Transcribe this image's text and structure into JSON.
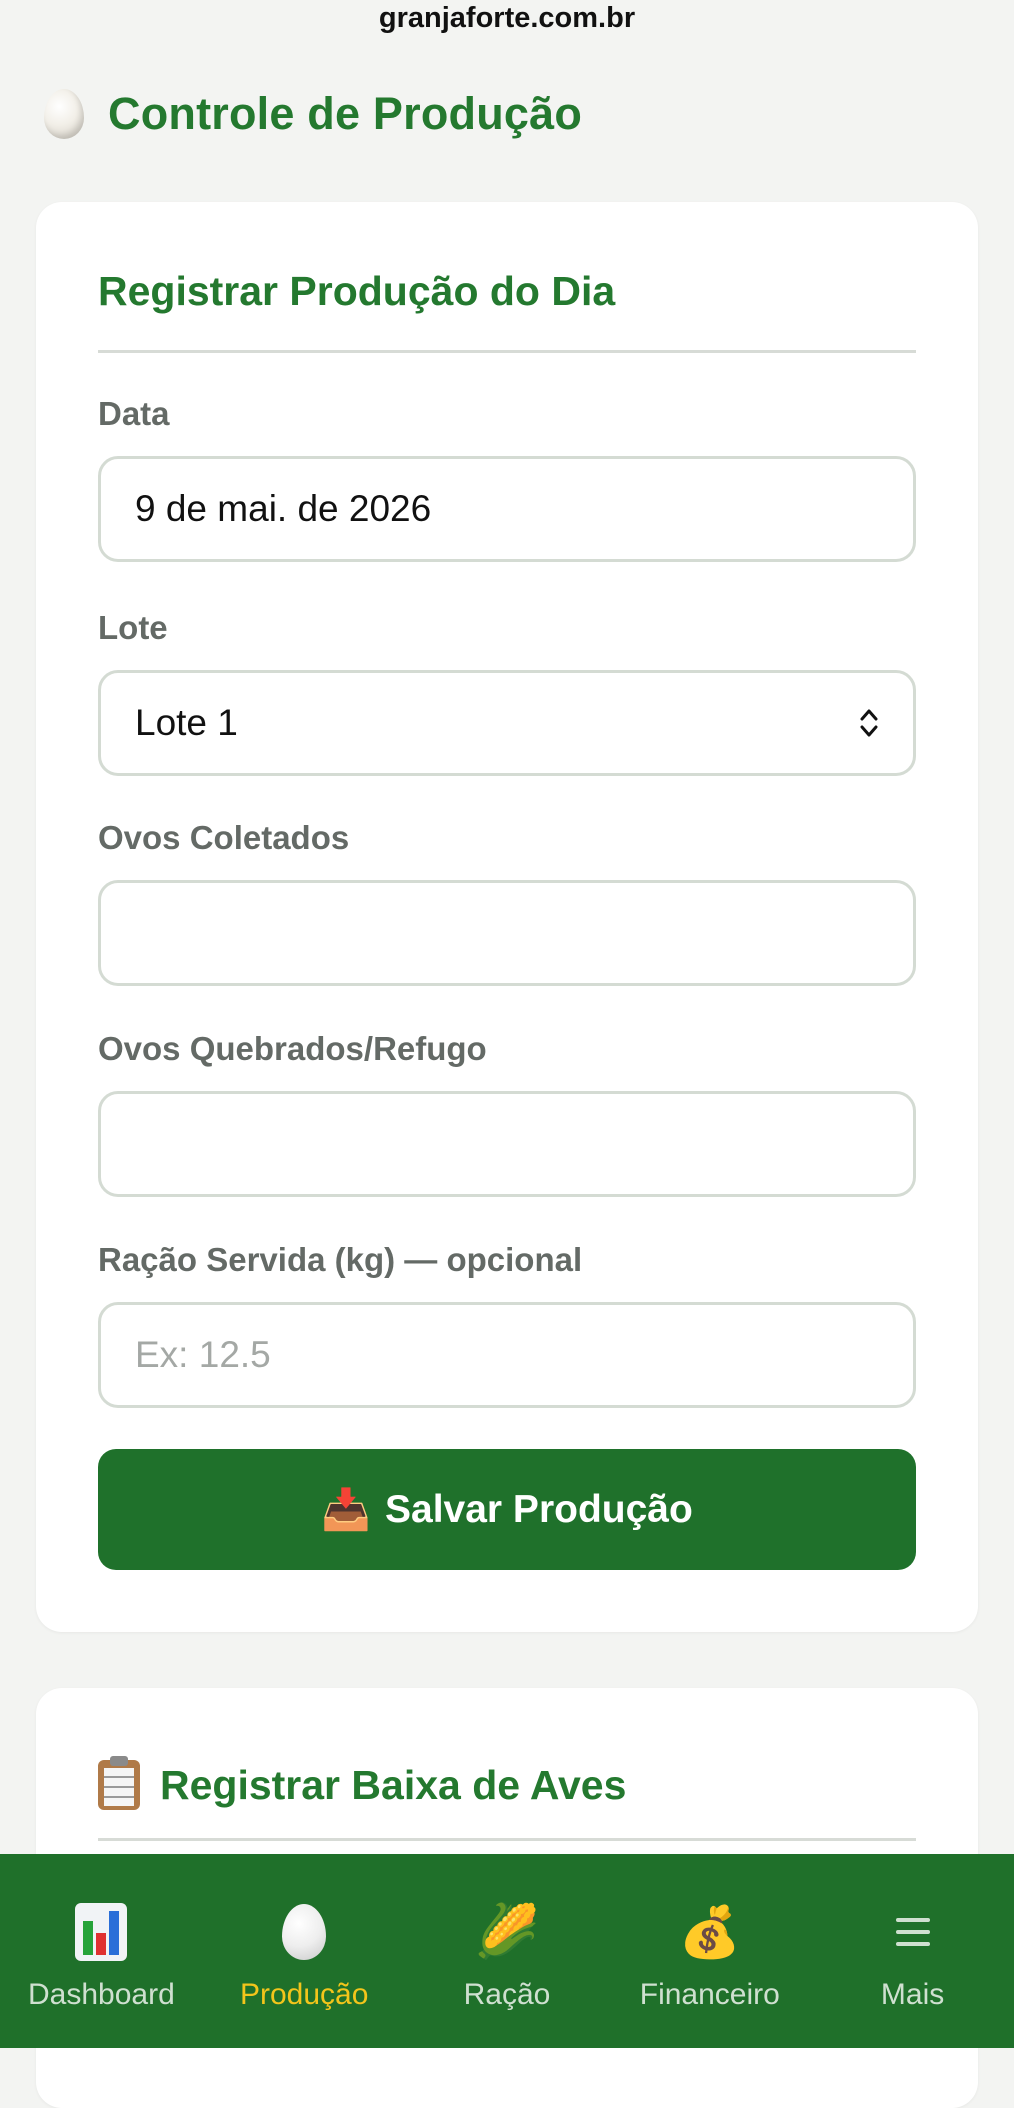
{
  "browser": {
    "url": "granjaforte.com.br"
  },
  "header": {
    "title": "Controle de Produção",
    "icon": "egg-icon"
  },
  "production_form": {
    "title": "Registrar Produção do Dia",
    "date": {
      "label": "Data",
      "value": "9 de mai. de 2026"
    },
    "lot": {
      "label": "Lote",
      "value": "Lote 1"
    },
    "eggs_collected": {
      "label": "Ovos Coletados",
      "value": ""
    },
    "eggs_broken": {
      "label": "Ovos Quebrados/Refugo",
      "value": ""
    },
    "feed": {
      "label": "Ração Servida (kg) — opcional",
      "placeholder": "Ex: 12.5",
      "value": ""
    },
    "save_button": {
      "icon": "📥",
      "label": "Salvar Produção"
    }
  },
  "losses_form": {
    "icon": "clipboard-icon",
    "title": "Registrar Baixa de Aves"
  },
  "bottom_nav": {
    "items": [
      {
        "label": "Dashboard",
        "icon": "bar-chart-icon",
        "active": false
      },
      {
        "label": "Produção",
        "icon": "egg-icon",
        "active": true
      },
      {
        "label": "Ração",
        "icon": "corn-icon",
        "active": false
      },
      {
        "label": "Financeiro",
        "icon": "money-bag-icon",
        "active": false
      },
      {
        "label": "Mais",
        "icon": "menu-icon",
        "active": false
      }
    ]
  },
  "colors": {
    "brand_green": "#24792f",
    "nav_bg": "#1f702a",
    "active_nav": "#f3c51b"
  }
}
